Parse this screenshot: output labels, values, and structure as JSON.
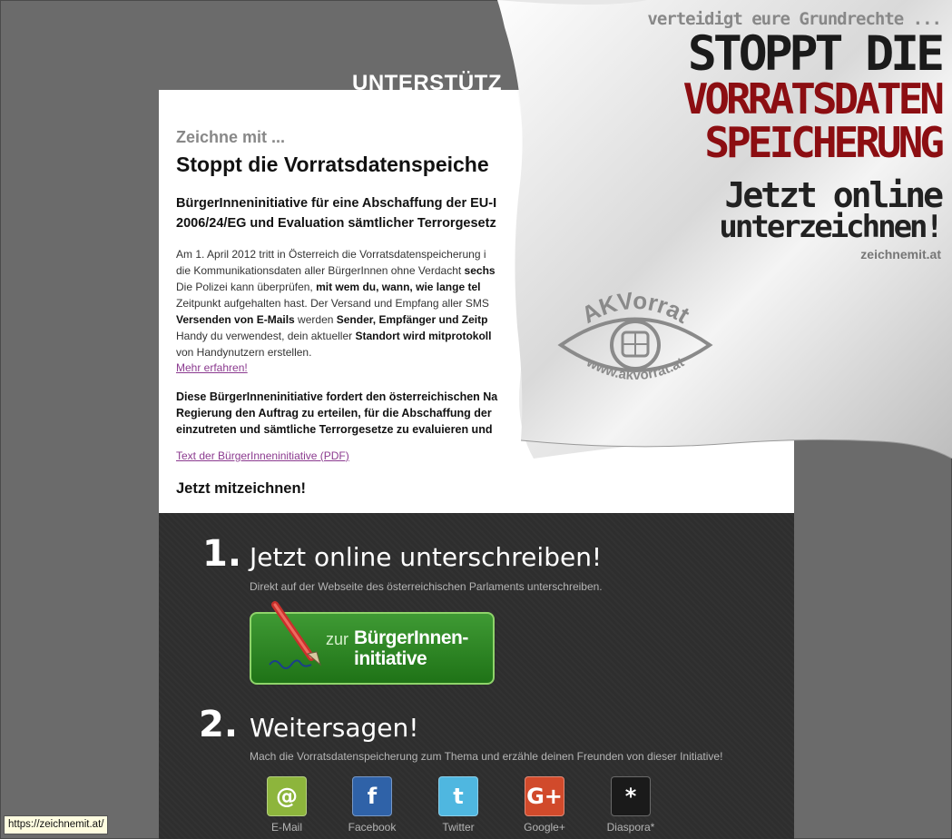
{
  "header": {
    "heading": "UNTERSTÜTZ"
  },
  "panel": {
    "kicker": "Zeichne mit ...",
    "title": "Stoppt die Vorratsdatenspeiche",
    "subtitle_line1": "BürgerInneninitiative für eine Abschaffung der EU-I",
    "subtitle_line2": "2006/24/EG und Evaluation sämtlicher Terrorgesetz",
    "body": {
      "l1_a": "Am 1. April 2012 tritt in Österreich die Vorratsdatenspeicherung i",
      "l2_a": "die Kommunikationsdaten aller BürgerInnen ohne Verdacht ",
      "l2_b": "sechs",
      "l3_a": "Die Polizei kann überprüfen, ",
      "l3_b": "mit wem du, wann, wie lange tel",
      "l4_a": "Zeitpunkt aufgehalten hast. Der Versand und Empfang aller SMS",
      "l5_b1": "Versenden von E-Mails",
      "l5_a": " werden ",
      "l5_b2": "Sender, Empfänger und Zeitp",
      "l6_a": "Handy du verwendest, dein aktueller ",
      "l6_b": "Standort wird mitprotokoll",
      "l7_a": "von Handynutzern erstellen."
    },
    "more_link": "Mehr erfahren!",
    "demands_l1": "Diese BürgerInneninitiative fordert den österreichischen Na",
    "demands_l2": "Regierung den Auftrag zu erteilen, für die Abschaffung der",
    "demands_l3": "einzutreten und sämtliche Terrorgesetze zu evaluieren und",
    "pdf_link": "Text der BürgerInneninitiative (PDF)",
    "cta": "Jetzt mitzeichnen!"
  },
  "step1": {
    "number": "1.",
    "title": "Jetzt online unterschreiben!",
    "desc": "Direkt auf der Webseite des österreichischen Parlaments unterschreiben.",
    "button_lead": "zur",
    "button_line1": "BürgerInnen-",
    "button_line2": "initiative"
  },
  "step2": {
    "number": "2.",
    "title": "Weitersagen!",
    "desc": "Mach die Vorratsdatenspeicherung zum Thema und erzähle deinen Freunden von dieser Initiative!"
  },
  "share": [
    {
      "label": "E-Mail",
      "glyph": "@",
      "color": "#8db53c",
      "icon": "email-icon"
    },
    {
      "label": "Facebook",
      "glyph": "f",
      "color": "#2f62a8",
      "icon": "facebook-icon"
    },
    {
      "label": "Twitter",
      "glyph": "t",
      "color": "#4fb7e0",
      "icon": "twitter-icon"
    },
    {
      "label": "Google+",
      "glyph": "G+",
      "color": "#d14a2b",
      "icon": "google-plus-icon"
    },
    {
      "label": "Diaspora*",
      "glyph": "*",
      "color": "#1a1a1a",
      "icon": "diaspora-icon"
    }
  ],
  "peel": {
    "line1": "verteidigt eure Grundrechte ...",
    "line2": "STOPPT DIE",
    "line3": "VORRATSDATEN",
    "line4": "SPEICHERUNG",
    "line5": "Jetzt online",
    "line6": "unterzeichnen!",
    "line7": "zeichnemit.at",
    "logo_top": "AKVorrat",
    "logo_bottom": "www.akvorrat.at"
  },
  "statusbar": {
    "url": "https://zeichnemit.at/"
  }
}
